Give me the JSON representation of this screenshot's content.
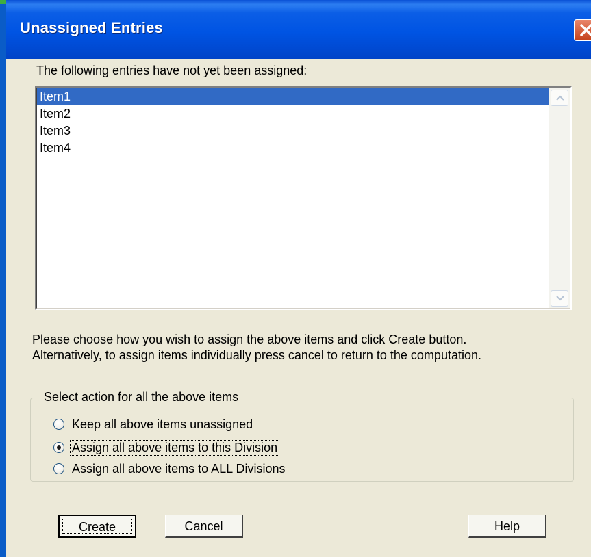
{
  "window": {
    "title": "Unassigned Entries"
  },
  "list": {
    "label": "The following entries have not yet been assigned:",
    "items": [
      {
        "label": "Item1",
        "selected": true
      },
      {
        "label": "Item2",
        "selected": false
      },
      {
        "label": "Item3",
        "selected": false
      },
      {
        "label": "Item4",
        "selected": false
      }
    ]
  },
  "instructions": {
    "line1": "Please choose how you wish to assign the above items and click Create button.",
    "line2": "Alternatively, to assign items individually press cancel  to return to the computation."
  },
  "group": {
    "title": "Select action for all the above items",
    "options": [
      {
        "label": "Keep all above items unassigned",
        "checked": false
      },
      {
        "label": "Assign all above items to this Division",
        "checked": true
      },
      {
        "label": "Assign all above items to ALL Divisions",
        "checked": false
      }
    ]
  },
  "buttons": {
    "create": "Create",
    "cancel": "Cancel",
    "help": "Help"
  }
}
